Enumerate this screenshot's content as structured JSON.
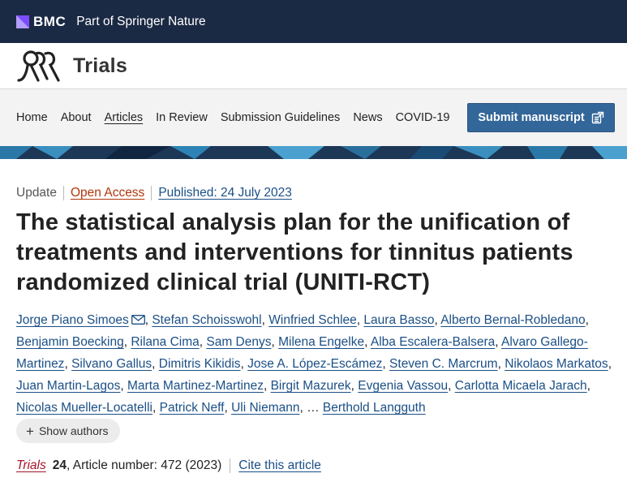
{
  "top_bar": {
    "brand": "BMC",
    "tagline": "Part of Springer Nature",
    "brand_color": "#1b2a44",
    "mark_color": "#7c4dff"
  },
  "journal": {
    "name": "Trials"
  },
  "nav": {
    "items": [
      "Home",
      "About",
      "Articles",
      "In Review",
      "Submission Guidelines",
      "News",
      "COVID-19"
    ],
    "active": "Articles",
    "submit_label": "Submit manuscript",
    "submit_color": "#336699"
  },
  "article": {
    "type": "Update",
    "access": "Open Access",
    "published": "Published: 24 July 2023",
    "title": "The statistical analysis plan for the unification of treatments and interventions for tinnitus patients randomized clinical trial (UNITI-RCT)",
    "authors": [
      "Jorge Piano Simoes",
      "Stefan Schoisswohl",
      "Winfried Schlee",
      "Laura Basso",
      "Alberto Bernal-Robledano",
      "Benjamin Boecking",
      "Rilana Cima",
      "Sam Denys",
      "Milena Engelke",
      "Alba Escalera-Balsera",
      "Alvaro Gallego-Martinez",
      "Silvano Gallus",
      "Dimitris Kikidis",
      "Jose A. López-Escámez",
      "Steven C. Marcrum",
      "Nikolaos Markatos",
      "Juan Martin-Lagos",
      "Marta Martinez-Martinez",
      "Birgit Mazurek",
      "Evgenia Vassou",
      "Carlotta Micaela Jarach",
      "Nicolas Mueller-Locatelli",
      "Patrick Neff",
      "Uli Niemann"
    ],
    "ellipsis": "…",
    "last_author": "Berthold Langguth",
    "show_authors_label": "Show authors",
    "citation": {
      "journal": "Trials",
      "volume": "24",
      "article_number": ", Article number: 472 (2023)",
      "cite_label": "Cite this article"
    },
    "colors": {
      "link": "#1b4f86",
      "open_access": "#b1360a",
      "journal_ref": "#a6152b"
    }
  }
}
